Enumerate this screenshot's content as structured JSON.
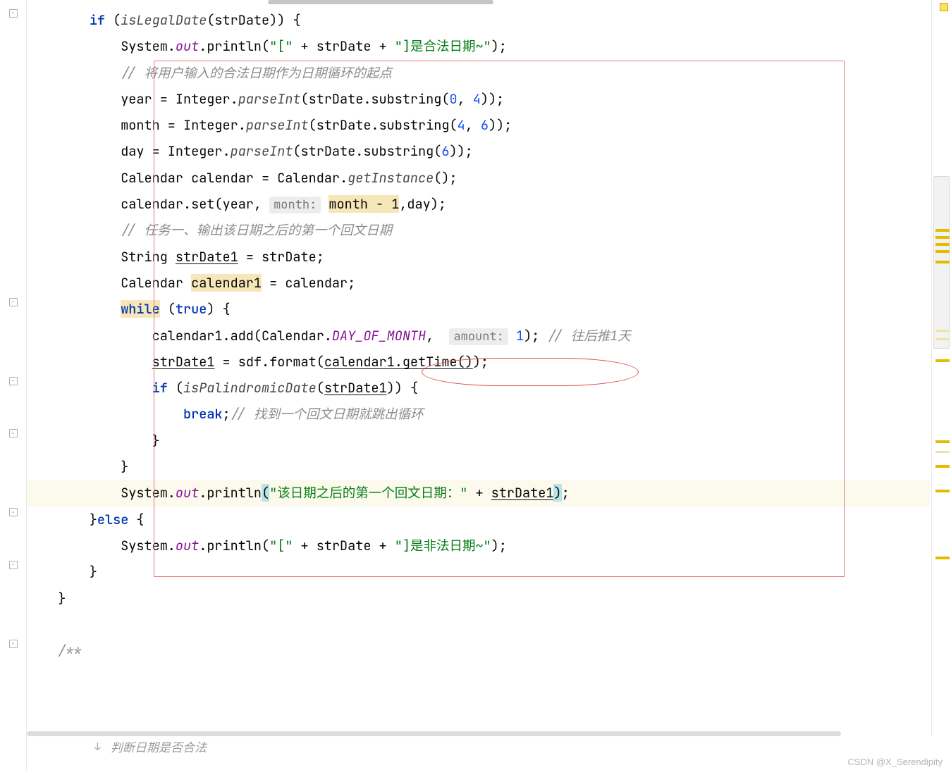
{
  "watermark": "CSDN @X_Serendipity",
  "bottom_hint": "判断日期是否合法",
  "folds": [
    "−",
    "−",
    "−",
    "−",
    "−",
    "−",
    "−"
  ],
  "minimap": {
    "yellow_marks": [
      325,
      335,
      345,
      355,
      370,
      510,
      625,
      660,
      695,
      790
    ],
    "faint_marks": [
      468,
      480,
      640
    ]
  },
  "code": {
    "l1": {
      "if": "if",
      "p1": " (",
      "fn": "isLegalDate",
      "p2": "(strDate)) {"
    },
    "l2": {
      "a": "System.",
      "out": "out",
      "b": ".println(",
      "s1": "\"[\"",
      "c": " + strDate + ",
      "s2": "\"]是合法日期~\"",
      "d": ");"
    },
    "l3": {
      "c": "// 将用户输入的合法日期作为日期循环的起点"
    },
    "l4": {
      "a": "year = Integer.",
      "m": "parseInt",
      "b": "(strDate.substring(",
      "n1": "0",
      "c": ", ",
      "n2": "4",
      "d": "));"
    },
    "l5": {
      "a": "month = Integer.",
      "m": "parseInt",
      "b": "(strDate.substring(",
      "n1": "4",
      "c": ", ",
      "n2": "6",
      "d": "));"
    },
    "l6": {
      "a": "day = Integer.",
      "m": "parseInt",
      "b": "(strDate.substring(",
      "n1": "6",
      "c": "));"
    },
    "l7": {
      "a": "Calendar calendar = Calendar.",
      "m": "getInstance",
      "b": "();"
    },
    "l8": {
      "a": "calendar.set(year, ",
      "hint": "month:",
      "sp": " ",
      "hl": "month - 1",
      "b": ",day);"
    },
    "l9": {
      "c": "// 任务一、输出该日期之后的第一个回文日期"
    },
    "l10": {
      "a": "String ",
      "u": "strDate1",
      "b": " = strDate;"
    },
    "l11": {
      "a": "Calendar ",
      "hl": "calendar1",
      "b": " = calendar;"
    },
    "l12": {
      "kw": "while",
      "a": " (",
      "tr": "true",
      "b": ") {"
    },
    "l13": {
      "a": "calendar1.add(Calendar.",
      "const": "DAY_OF_MONTH",
      "b": ",  ",
      "hint": "amount:",
      "sp": " ",
      "n": "1",
      "c": "); ",
      "cm": "// 往后推1天"
    },
    "l14": {
      "u1": "strDate1",
      "a": " = sdf.format(",
      "u2": "calendar1.getTime()",
      "b": ");"
    },
    "l15": {
      "kw": "if",
      "a": " (",
      "fn": "isPalindromicDate",
      "b": "(",
      "u": "strDate1",
      "c": ")) {"
    },
    "l16": {
      "kw": "break",
      "a": ";",
      "cm": "// 找到一个回文日期就跳出循环"
    },
    "l17": {
      "a": "}"
    },
    "l18": {
      "a": "}"
    },
    "l19": {
      "a": "System.",
      "out": "out",
      "b": ".println",
      "h1": "(",
      "s": "\"该日期之后的第一个回文日期：\"",
      "c": " + ",
      "u": "strDate1",
      "h2": ")",
      "d": ";"
    },
    "l20": {
      "a": "}",
      "kw": "else",
      "b": " {"
    },
    "l21": {
      "a": "System.",
      "out": "out",
      "b": ".println(",
      "s1": "\"[\"",
      "c": " + strDate + ",
      "s2": "\"]是非法日期~\"",
      "d": ");"
    },
    "l22": {
      "a": "}"
    },
    "l23": {
      "a": "}"
    },
    "l24": {
      "a": ""
    },
    "l25": {
      "c": "/**"
    }
  }
}
